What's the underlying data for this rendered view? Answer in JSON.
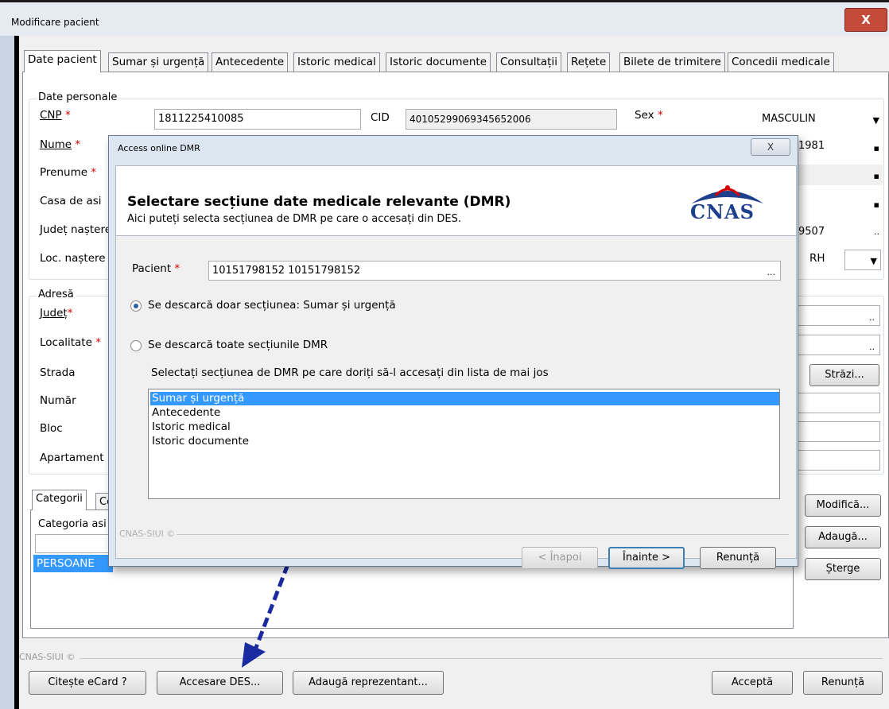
{
  "window": {
    "title": "Modificare pacient",
    "close_glyph": "X"
  },
  "tabs": [
    "Date pacient",
    "Sumar și urgență",
    "Antecedente",
    "Istoric medical",
    "Istoric documente",
    "Consultații",
    "Rețete",
    "Bilete de trimitere",
    "Concedii medicale"
  ],
  "personal": {
    "group_label": "Date personale",
    "cnp_label": "CNP",
    "cnp_value": "1811225410085",
    "cid_label": "CID",
    "cid_value": "40105299069345652006",
    "sex_label": "Sex",
    "sex_value": "MASCULIN",
    "nume_label": "Nume",
    "prenume_label": "Prenume",
    "casa_label": "Casa de asi",
    "judet_nastere_label": "Județ naștere",
    "loc_nastere_label": "Loc. naștere",
    "data_value": "1981",
    "code_value": "9507",
    "rh_label": "RH",
    "required_mark": "*"
  },
  "address": {
    "group_label": "Adresă",
    "judet_label": "Județ",
    "localitate_label": "Localitate",
    "strada_label": "Strada",
    "numar_label": "Număr",
    "bloc_label": "Bloc",
    "apartament_label": "Apartament",
    "strazi_button": "Străzi..."
  },
  "categories": {
    "tab1": "Categorii",
    "tab2_partial": "Ce",
    "column_header": "Categoria asi",
    "row_value": "PERSOANE",
    "modifica_button": "Modifică...",
    "adauga_button": "Adaugă...",
    "sterge_button": "Șterge"
  },
  "footer": {
    "brand": "CNAS-SIUI ©",
    "citeste_button": "Citește eCard ?",
    "accesare_button": "Accesare DES...",
    "reprezentant_button": "Adaugă reprezentant...",
    "accepta_button": "Acceptă",
    "renunta_button": "Renunță"
  },
  "dialog": {
    "title": "Access online DMR",
    "close_glyph": "X",
    "heading": "Selectare secțiune date medicale relevante (DMR)",
    "subheading": "Aici puteți selecta secțiunea de DMR pe care o accesați din DES.",
    "logo_text": "CNAS",
    "pacient_label": "Pacient",
    "pacient_value": "10151798152 10151798152",
    "radio1_label": "Se descarcă doar secțiunea: Sumar și urgență",
    "radio2_label": "Se descarcă toate secțiunile DMR",
    "instruction": "Selectați secțiunea de DMR pe care doriți să-l accesați din lista de mai jos",
    "sections": [
      "Sumar și urgență",
      "Antecedente",
      "Istoric medical",
      "Istoric documente"
    ],
    "selected_index": 0,
    "brand": "CNAS-SIUI ©",
    "back_button": "< Înapoi",
    "next_button": "Înainte >",
    "cancel_button": "Renunță"
  },
  "colors": {
    "selection": "#3399ff",
    "arrow": "#1a2aa0",
    "required": "#d40000"
  }
}
